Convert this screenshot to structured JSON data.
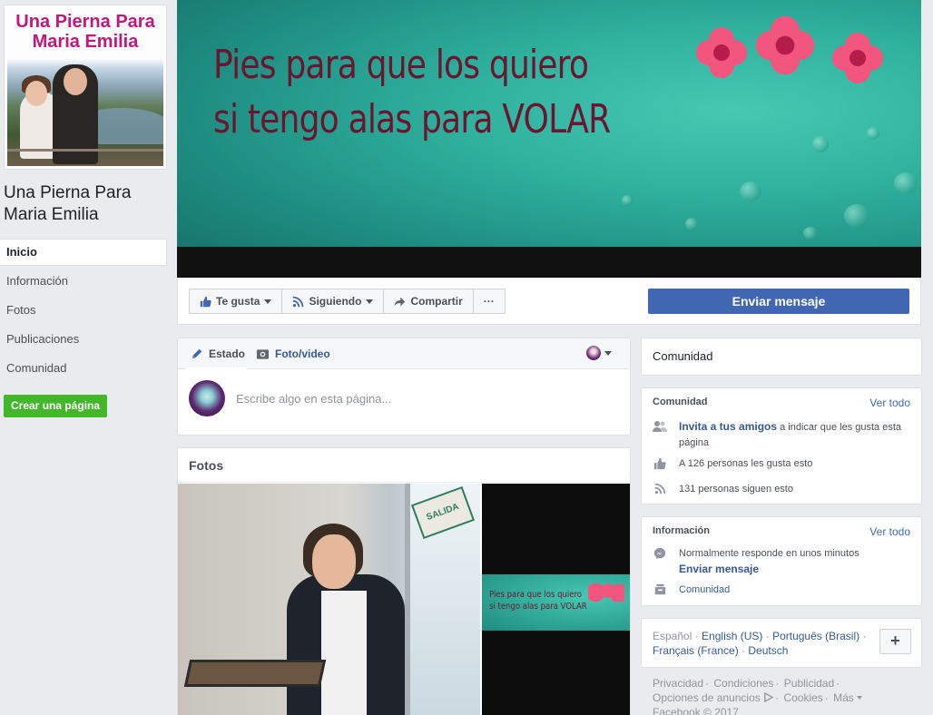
{
  "page": {
    "name": "Una Pierna Para Maria Emilia",
    "profile_pic_text": "Una Pierna Para Maria Emilia"
  },
  "cover": {
    "line1": "Pies para que los quiero",
    "line2": "si tengo alas para  VOLAR"
  },
  "sidebar": {
    "items": [
      {
        "label": "Inicio",
        "active": true
      },
      {
        "label": "Información"
      },
      {
        "label": "Fotos"
      },
      {
        "label": "Publicaciones"
      },
      {
        "label": "Comunidad"
      }
    ],
    "create_page": "Crear una página"
  },
  "actions": {
    "like": "Te gusta",
    "following": "Siguiendo",
    "share": "Compartir",
    "more": "···",
    "send_message": "Enviar mensaje"
  },
  "composer": {
    "tab_status": "Estado",
    "tab_photo": "Foto/video",
    "placeholder": "Escribe algo en esta página..."
  },
  "photos": {
    "title": "Fotos",
    "sign_text": "SALIDA",
    "mini_quote_1": "Pies para que los quiero",
    "mini_quote_2": "si tengo alas para  VOLAR"
  },
  "community_header": "Comunidad",
  "community": {
    "title": "Comunidad",
    "see_all": "Ver todo",
    "invite_link": "Invita a tus amigos",
    "invite_rest": " a indicar que les gusta esta página",
    "likes": "A 126 personas les gusta esto",
    "followers": "131 personas siguen esto"
  },
  "info": {
    "title": "Información",
    "see_all": "Ver todo",
    "response": "Normalmente responde en unos minutos",
    "send_message": "Enviar mensaje",
    "category": "Comunidad"
  },
  "languages": {
    "items": [
      "Español",
      "English (US)",
      "Português (Brasil)",
      "Français (France)",
      "Deutsch"
    ],
    "add": "+"
  },
  "footer": {
    "privacy": "Privacidad",
    "terms": "Condiciones",
    "advertising": "Publicidad",
    "ad_choices": "Opciones de anuncios",
    "cookies": "Cookies",
    "more": "Más",
    "copyright": "Facebook © 2017"
  },
  "colors": {
    "fb_blue": "#4267b2",
    "link_blue": "#365899",
    "green": "#42b72a",
    "bg": "#e9ebee"
  }
}
